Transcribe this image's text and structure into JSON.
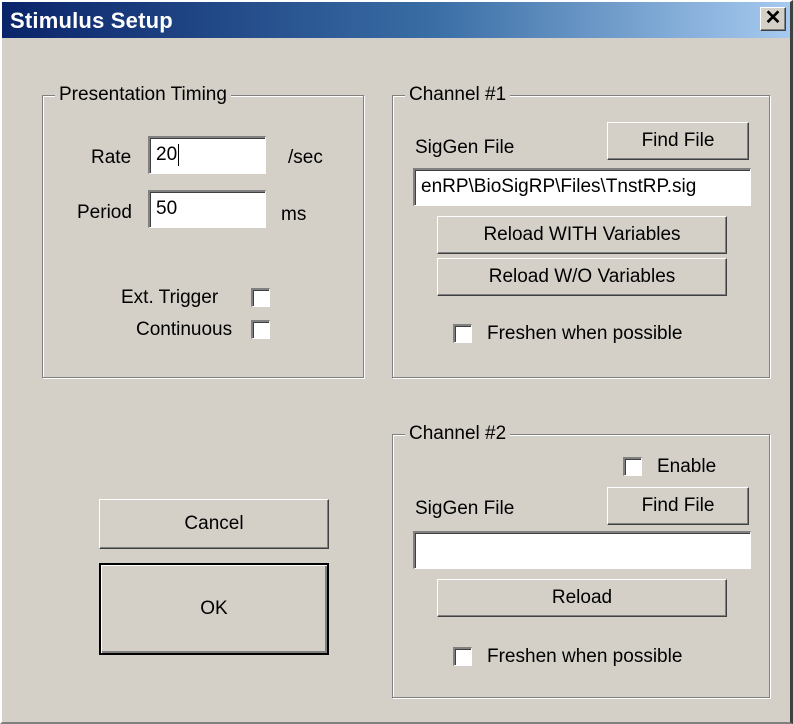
{
  "window": {
    "title": "Stimulus Setup",
    "close_glyph": "✕"
  },
  "timing": {
    "legend": "Presentation Timing",
    "rate_label": "Rate",
    "rate_value": "20",
    "rate_unit": "/sec",
    "period_label": "Period",
    "period_value": "50",
    "period_unit": "ms",
    "ext_trigger_label": "Ext. Trigger",
    "continuous_label": "Continuous"
  },
  "channel1": {
    "legend": "Channel #1",
    "siggen_label": "SigGen File",
    "find_file_label": "Find File",
    "file_path": "enRP\\BioSigRP\\Files\\TnstRP.sig",
    "reload_with_label": "Reload WITH Variables",
    "reload_without_label": "Reload W/O Variables",
    "freshen_label": "Freshen when possible"
  },
  "channel2": {
    "legend": "Channel #2",
    "enable_label": "Enable",
    "siggen_label": "SigGen File",
    "find_file_label": "Find File",
    "file_path": "",
    "reload_label": "Reload",
    "freshen_label": "Freshen when possible"
  },
  "buttons": {
    "cancel_label": "Cancel",
    "ok_label": "OK"
  },
  "checkbox_states": {
    "ext_trigger": false,
    "continuous": false,
    "ch1_freshen": false,
    "ch2_enable": false,
    "ch2_freshen": false
  }
}
